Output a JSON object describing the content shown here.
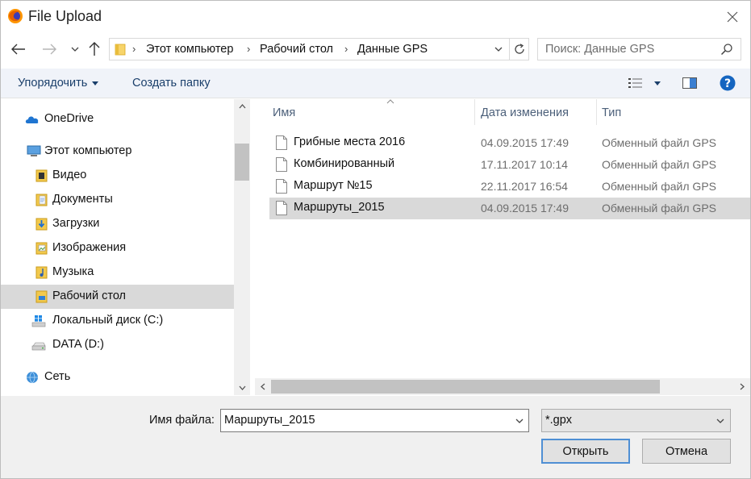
{
  "window": {
    "title": "File Upload",
    "app_icon": "firefox-icon",
    "close_icon": "close-icon"
  },
  "nav": {
    "back_icon": "arrow-left-icon",
    "forward_icon": "arrow-right-icon",
    "recent_icon": "chevron-down-icon",
    "up_icon": "arrow-up-icon"
  },
  "address": {
    "crumbs": [
      "Этот компьютер",
      "Рабочий стол",
      "Данные GPS"
    ],
    "refresh_icon": "refresh-icon"
  },
  "search": {
    "placeholder": "Поиск: Данные GPS",
    "icon": "search-icon"
  },
  "toolbar": {
    "organize_label": "Упорядочить",
    "new_folder_label": "Создать папку",
    "view_icon": "view-list-icon",
    "preview_icon": "preview-pane-icon",
    "help_icon": "help-icon"
  },
  "sidebar": {
    "items": [
      {
        "label": "OneDrive",
        "icon": "onedrive-icon"
      },
      {
        "label": "Этот компьютер",
        "icon": "computer-icon"
      },
      {
        "label": "Видео",
        "icon": "video-folder-icon"
      },
      {
        "label": "Документы",
        "icon": "documents-folder-icon"
      },
      {
        "label": "Загрузки",
        "icon": "downloads-folder-icon"
      },
      {
        "label": "Изображения",
        "icon": "pictures-folder-icon"
      },
      {
        "label": "Музыка",
        "icon": "music-folder-icon"
      },
      {
        "label": "Рабочий стол",
        "icon": "desktop-folder-icon",
        "selected": true
      },
      {
        "label": "Локальный диск (C:)",
        "icon": "windows-drive-icon"
      },
      {
        "label": "DATA (D:)",
        "icon": "drive-icon"
      },
      {
        "label": "Сеть",
        "icon": "network-icon"
      }
    ]
  },
  "filelist": {
    "columns": [
      "Имя",
      "Дата изменения",
      "Тип"
    ],
    "rows": [
      {
        "name": "Грибные места 2016",
        "date": "04.09.2015 17:49",
        "type": "Обменный файл GPS",
        "selected": false
      },
      {
        "name": "Комбинированный",
        "date": "17.11.2017 10:14",
        "type": "Обменный файл GPS",
        "selected": false
      },
      {
        "name": "Маршрут №15",
        "date": "22.11.2017 16:54",
        "type": "Обменный файл GPS",
        "selected": false
      },
      {
        "name": "Маршруты_2015",
        "date": "04.09.2015 17:49",
        "type": "Обменный файл GPS",
        "selected": true
      }
    ]
  },
  "footer": {
    "filename_label": "Имя файла:",
    "filename_value": "Маршруты_2015",
    "filter_value": "*.gpx",
    "open_label": "Открыть",
    "cancel_label": "Отмена"
  },
  "colors": {
    "accent": "#1a3f6b",
    "selection": "#d9d9d9",
    "toolbar_bg": "#f0f3f9",
    "primary_border": "#4f8fd4",
    "help_blue": "#1565c0"
  }
}
